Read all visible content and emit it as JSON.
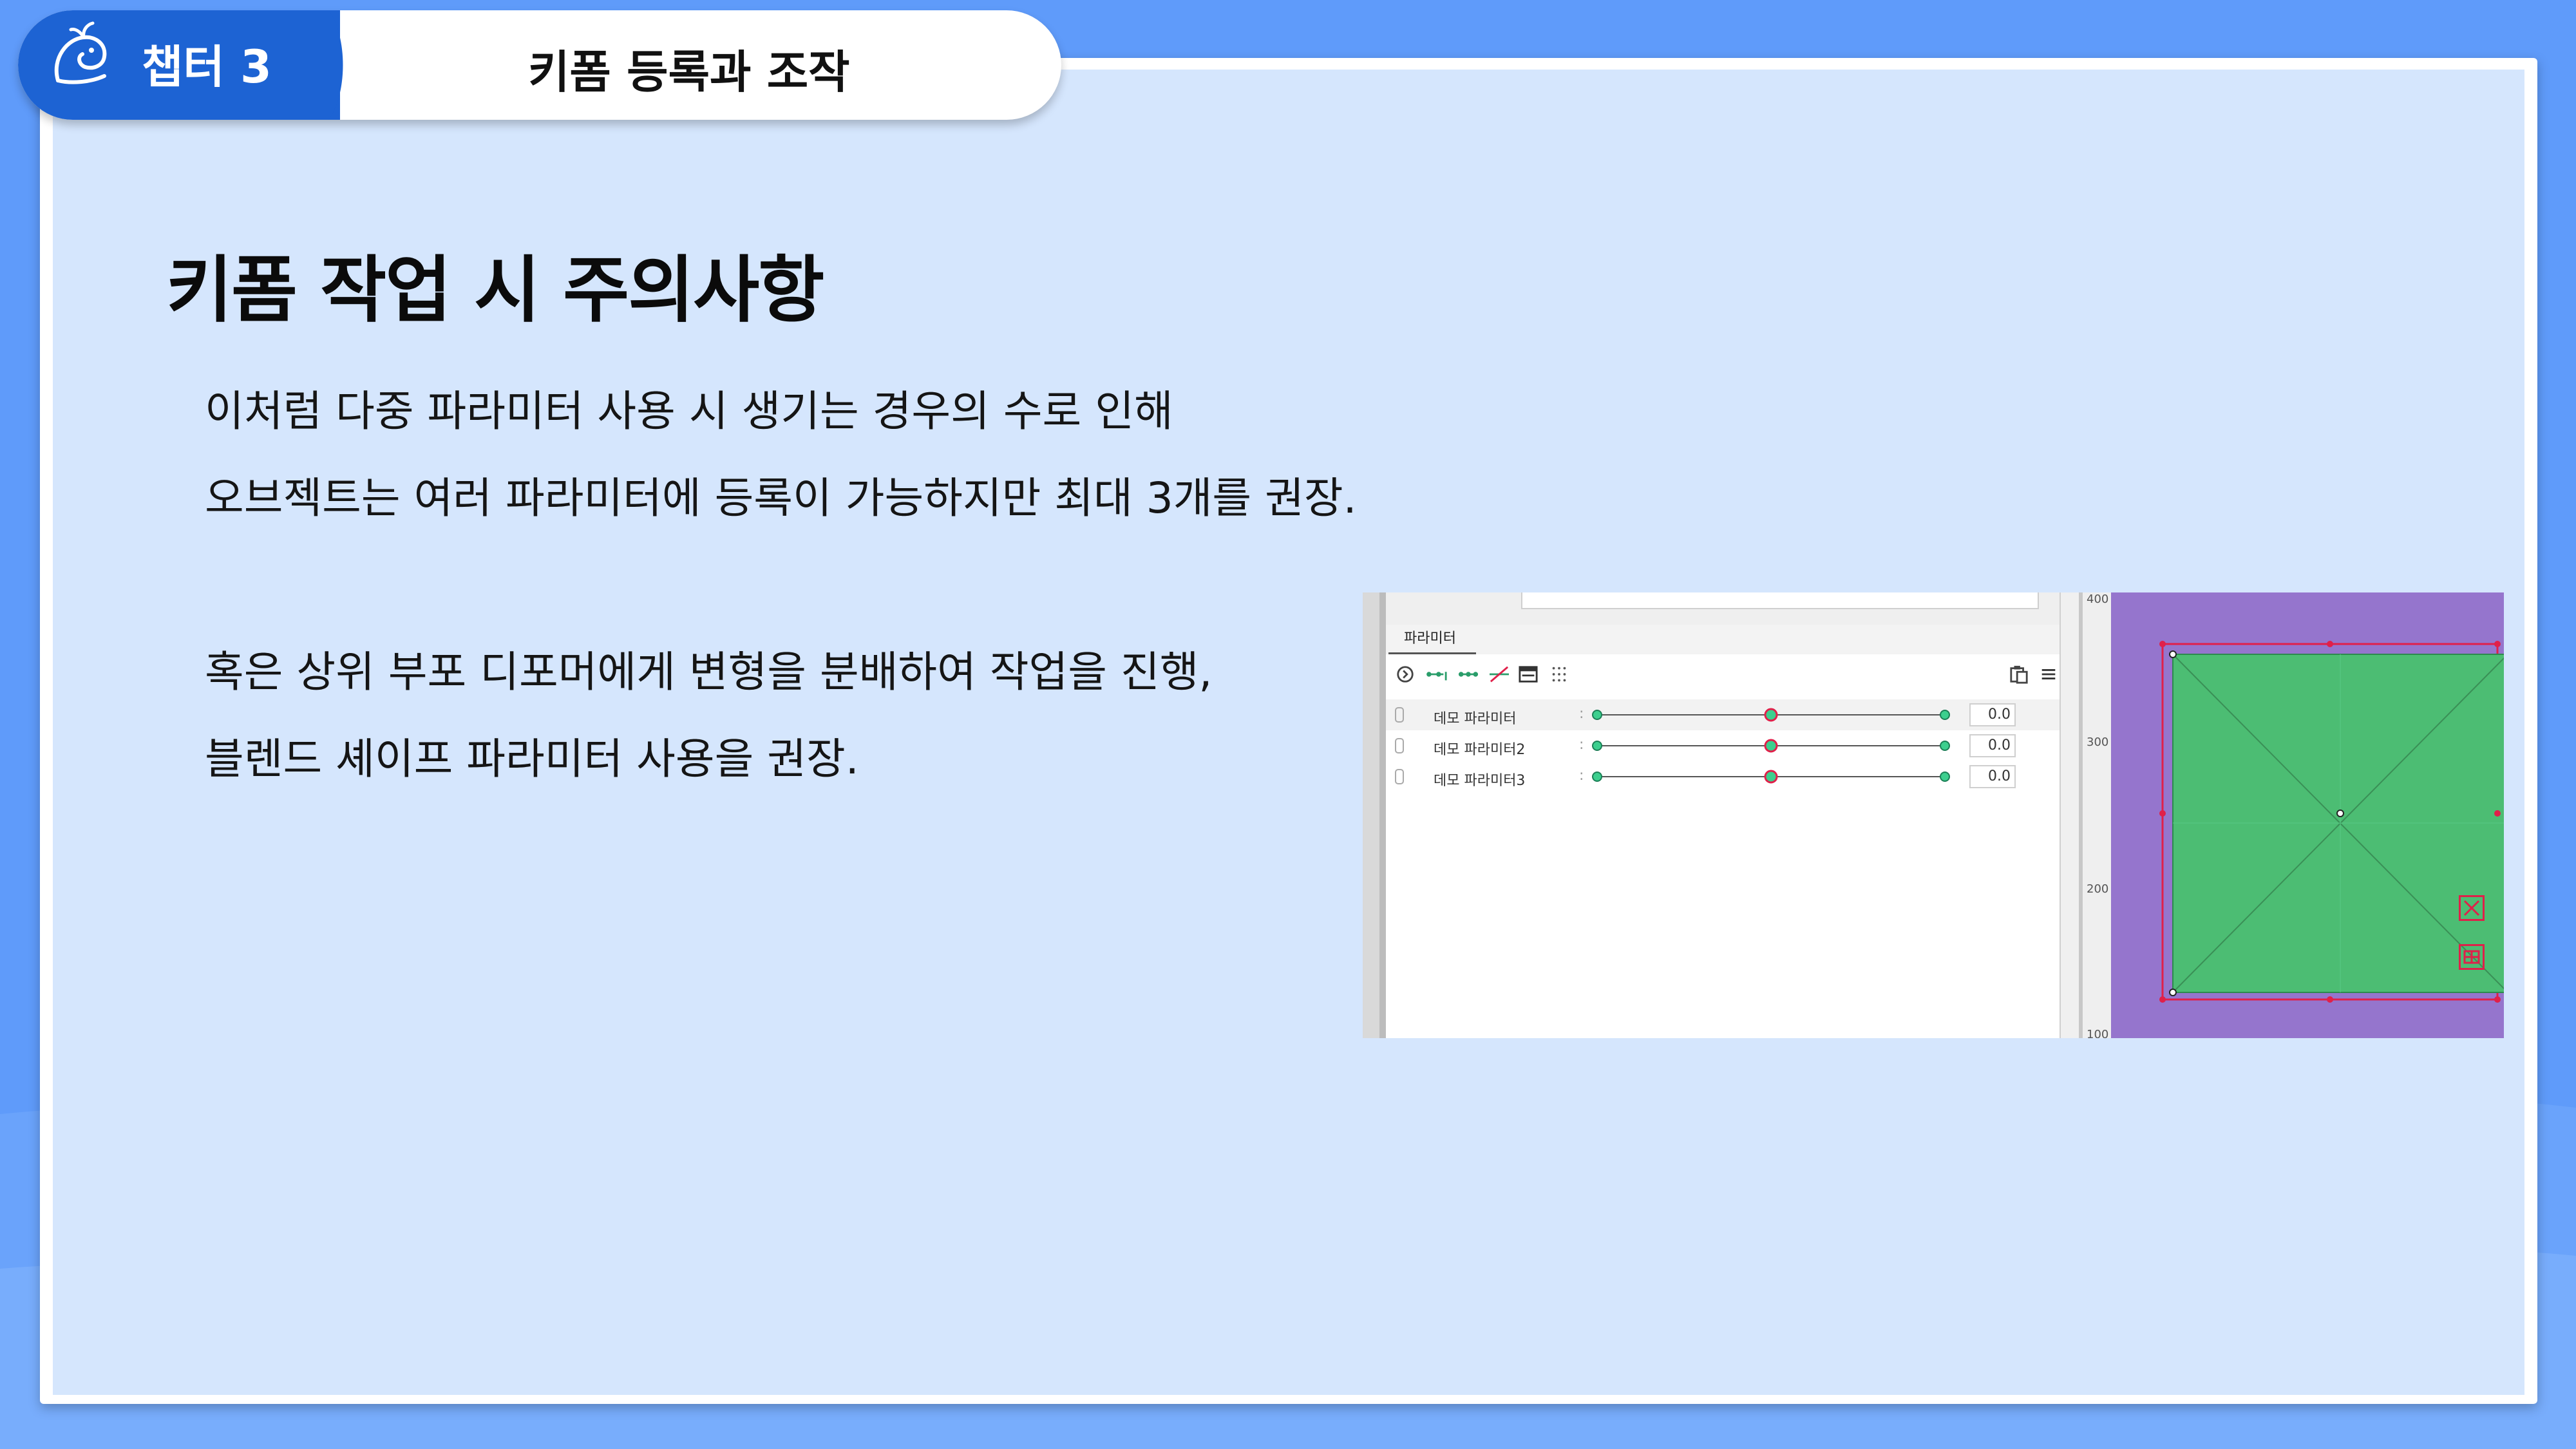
{
  "header": {
    "chapter_label": "챕터 3",
    "title": "키폼 등록과 조작"
  },
  "slide": {
    "heading": "키폼 작업 시 주의사항",
    "paragraph1": [
      "이처럼 다중 파라미터 사용 시 생기는 경우의 수로 인해",
      "오브젝트는 여러 파라미터에 등록이 가능하지만 최대 3개를 권장."
    ],
    "paragraph2": [
      "혹은 상위 부포 디포머에게 변형을 분배하여 작업을 진행,",
      "블렌드 셰이프 파라미터 사용을 권장."
    ]
  },
  "screenshot": {
    "panel_tab": "파라미터",
    "parameters": [
      {
        "name": "데모 파라미터",
        "value": "0.0",
        "position": 0.5
      },
      {
        "name": "데모 파라미터2",
        "value": "0.0",
        "position": 0.5
      },
      {
        "name": "데모 파라미터3",
        "value": "0.0",
        "position": 0.5
      }
    ],
    "ruler_labels": [
      "400",
      "300",
      "200",
      "100"
    ]
  },
  "colors": {
    "background": "#5f9bfa",
    "slide": "#d5e6fd",
    "chapter_tab": "#1d63d3",
    "canvas_bg": "#9575cd",
    "mesh_fill": "#4cbd73",
    "handle_red": "#e0204a"
  }
}
